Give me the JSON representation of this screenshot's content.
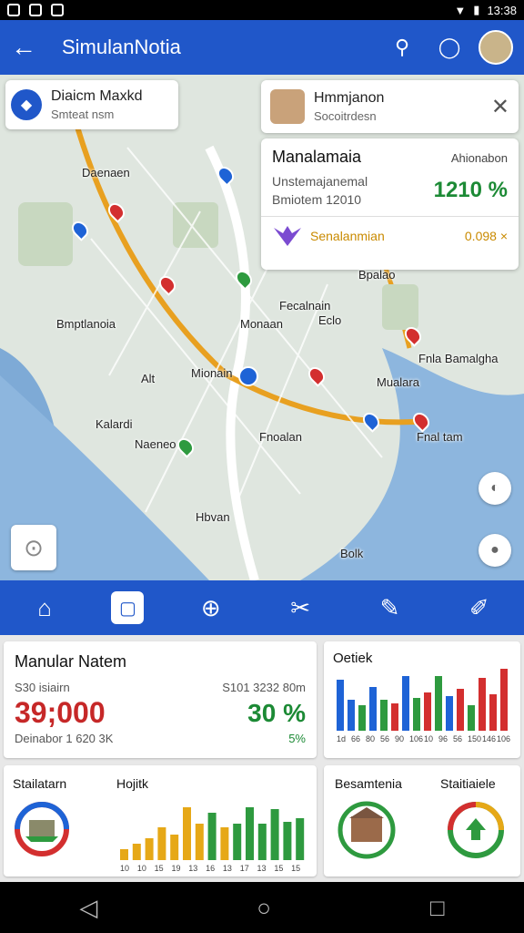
{
  "status": {
    "time": "13:38"
  },
  "appbar": {
    "title": "SimulanNotia",
    "back_icon": "arrow-left-icon",
    "search_icon": "search-icon",
    "chat_icon": "chat-icon"
  },
  "map": {
    "card1": {
      "title": "Diaicm Maxkd",
      "subtitle": "Smteat nsm"
    },
    "card2": {
      "title": "Hmmjanon",
      "subtitle": "Socoitrdesn"
    },
    "card3": {
      "title": "Manalamaia",
      "right_small": "Ahionabon",
      "line1": "Unstemajanemal",
      "line2": "Bmiotem 12010",
      "percent": "1210 %",
      "brand": "Senalanmian",
      "brand_value": "0.098 ×"
    },
    "labels": [
      "Daenaen",
      "Bmptlanoia",
      "Alt",
      "Kalardi",
      "Naeneo",
      "Hbvan",
      "Mionain",
      "Fnoalan",
      "Bpalao",
      "Fecalnain",
      "Monaan",
      "Mualara",
      "Fnla Bamalgha",
      "Fnal tam",
      "Eclo",
      "Bolk"
    ]
  },
  "tabs": [
    "home",
    "camera",
    "transit",
    "tool",
    "ruler",
    "edit"
  ],
  "panel1": {
    "title": "Manular Natem",
    "left_sub": "S30 isiairn",
    "right_sub": "S101 3232 80m",
    "big": "39;000",
    "percent": "30 %",
    "foot_left": "Deinabor 1 620 3K",
    "foot_right": "5%"
  },
  "panel2": {
    "title": "Oetiek",
    "x_ticks": [
      "1d",
      "66",
      "80",
      "56",
      "90",
      "106",
      "10",
      "96",
      "56",
      "150",
      "146",
      "106"
    ]
  },
  "panel3": {
    "title_left": "Stailatarn",
    "title_right": "Hojitk",
    "x_ticks": [
      "10",
      "10",
      "15",
      "19",
      "13",
      "16",
      "13",
      "17",
      "13",
      "15",
      "15"
    ]
  },
  "panel4": {
    "title_left": "Besamtenia",
    "title_right": "Staitiaiele"
  },
  "colors": {
    "primary": "#2057c9",
    "red": "#c62828",
    "green": "#1c8a35",
    "amber": "#e6a817"
  }
}
